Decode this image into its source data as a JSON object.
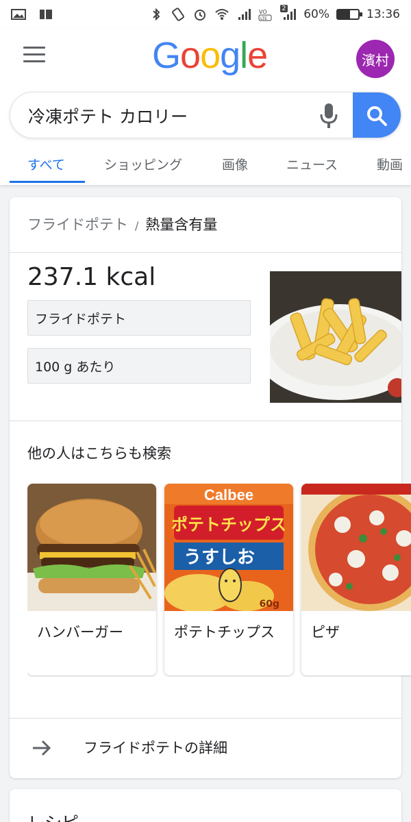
{
  "status_bar": {
    "battery_percent": "60%",
    "battery_level": 0.6,
    "time": "13:36",
    "sim_badge": "2"
  },
  "header": {
    "logo_letters": [
      "G",
      "o",
      "o",
      "g",
      "l",
      "e"
    ],
    "logo_colors": [
      "#4285f4",
      "#ea4335",
      "#fbbc05",
      "#4285f4",
      "#34a853",
      "#ea4335"
    ],
    "avatar_text": "濱村",
    "avatar_color": "#9c27b0"
  },
  "search": {
    "query": "冷凍ポテト カロリー"
  },
  "tabs": [
    "すべて",
    "ショッピング",
    "画像",
    "ニュース",
    "動画"
  ],
  "nutrition_card": {
    "breadcrumb_food": "フライドポテト",
    "breadcrumb_separator": "/",
    "breadcrumb_topic": "熱量含有量",
    "calories": "237.1 kcal",
    "food_select": "フライドポテト",
    "amount_select": "100 g あたり"
  },
  "related": {
    "title": "他の人はこちらも検索",
    "items": [
      {
        "label": "ハンバーガー"
      },
      {
        "label": "ポテトチップス"
      },
      {
        "label": "ピザ"
      }
    ],
    "chips_brand": "Calbee",
    "chips_name": "ポテトチップス",
    "chips_flavor": "うすしお",
    "chips_weight": "60g"
  },
  "more_link": "フライドポテトの詳細",
  "next_card_title": "レシピ",
  "colors": {
    "accent": "#1a73e8",
    "search_button": "#4285f4"
  }
}
